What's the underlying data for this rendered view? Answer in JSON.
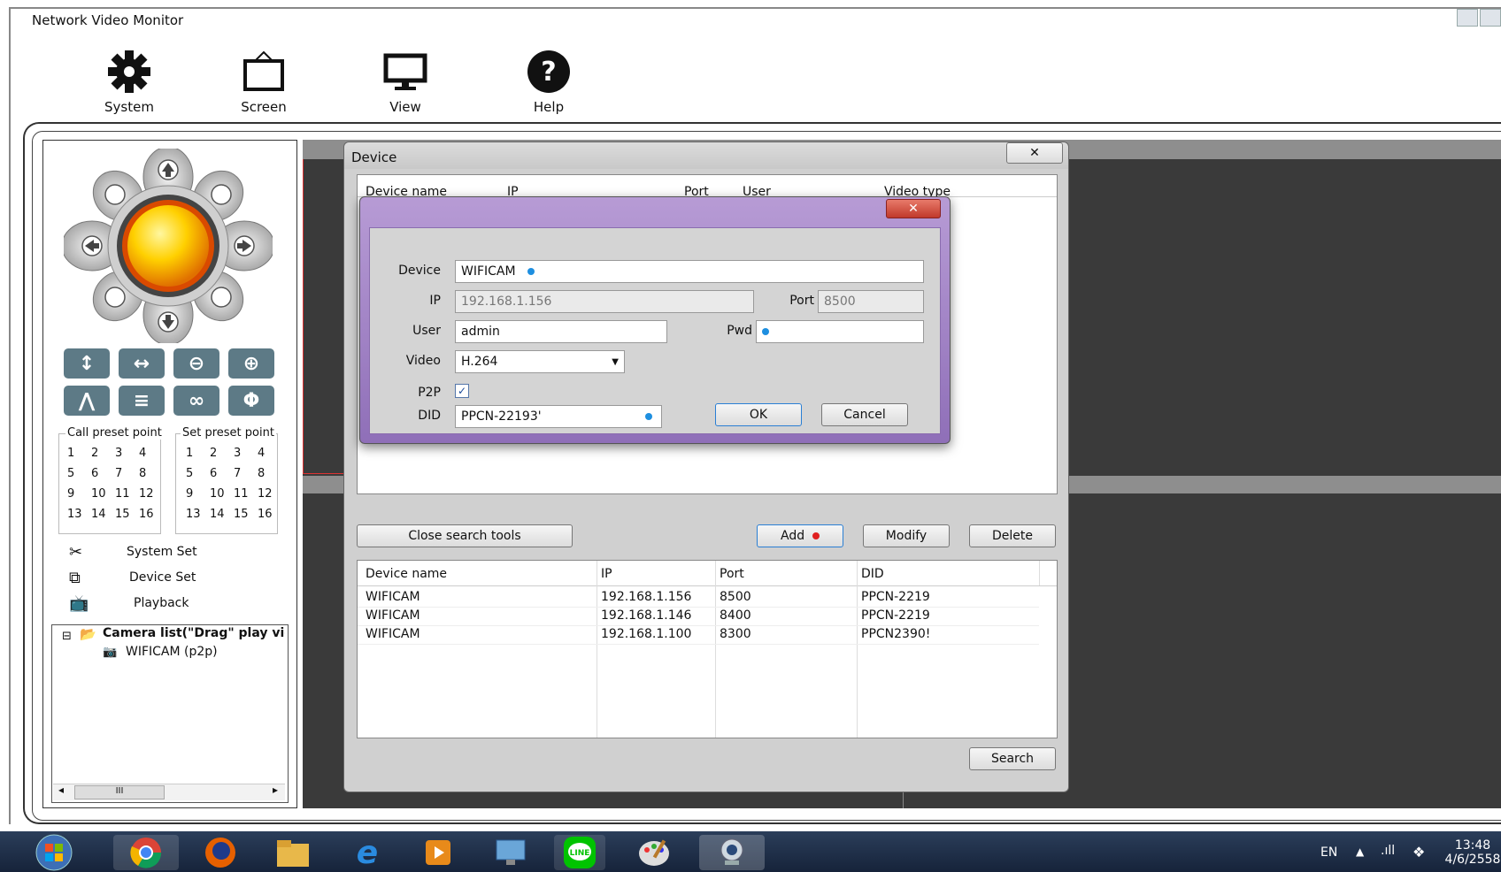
{
  "app": {
    "title": "Network Video Monitor"
  },
  "toolbar": {
    "system": "System",
    "screen": "Screen",
    "view": "View",
    "help": "Help"
  },
  "ptz": {
    "call_preset_title": "Call preset point",
    "set_preset_title": "Set preset point",
    "call_presets": [
      "1",
      "2",
      "3",
      "4",
      "5",
      "6",
      "7",
      "8",
      "9",
      "10",
      "11",
      "12",
      "13",
      "14",
      "15",
      "16"
    ],
    "set_presets": [
      "1",
      "2",
      "3",
      "4",
      "5",
      "6",
      "7",
      "8",
      "9",
      "10",
      "11",
      "12",
      "13",
      "14",
      "15",
      "16"
    ]
  },
  "menu": {
    "system_set": "System Set",
    "device_set": "Device Set",
    "playback": "Playback"
  },
  "tree": {
    "root": "Camera list(\"Drag\" play vid",
    "child": "WIFICAM (p2p)",
    "scroll_mark": "III"
  },
  "device_dialog": {
    "title": "Device",
    "close": "✕",
    "columns": [
      "Device name",
      "IP",
      "Port",
      "User",
      "Video type"
    ],
    "close_search_tools": "Close search tools",
    "add": "Add",
    "modify": "Modify",
    "delete": "Delete",
    "search": "Search",
    "search_columns": [
      "Device name",
      "IP",
      "Port",
      "DID"
    ],
    "search_rows": [
      {
        "name": "WIFICAM",
        "ip": "192.168.1.156",
        "port": "8500",
        "did": "PPCN-2219"
      },
      {
        "name": "WIFICAM",
        "ip": "192.168.1.146",
        "port": "8400",
        "did": "PPCN-2219"
      },
      {
        "name": "WIFICAM",
        "ip": "192.168.1.100",
        "port": "8300",
        "did": "PPCN2390!"
      }
    ]
  },
  "edit_dialog": {
    "close": "✕",
    "device_label": "Device",
    "device_value": "WIFICAM",
    "ip_label": "IP",
    "ip_value": "192.168.1.156",
    "port_label": "Port",
    "port_value": "8500",
    "user_label": "User",
    "user_value": "admin",
    "pwd_label": "Pwd",
    "video_label": "Video",
    "video_value": "H.264",
    "p2p_label": "P2P",
    "p2p_checked": true,
    "did_label": "DID",
    "did_value": "PPCN-22193'",
    "ok": "OK",
    "cancel": "Cancel"
  },
  "taskbar": {
    "lang": "EN",
    "time": "13:48",
    "date": "4/6/2558"
  },
  "colors": {
    "ptz_button": "#5d7a86",
    "accent_dot": "#1e8fe0",
    "add_dot": "#e02020",
    "dialog_purple": "#9b7cc4"
  }
}
